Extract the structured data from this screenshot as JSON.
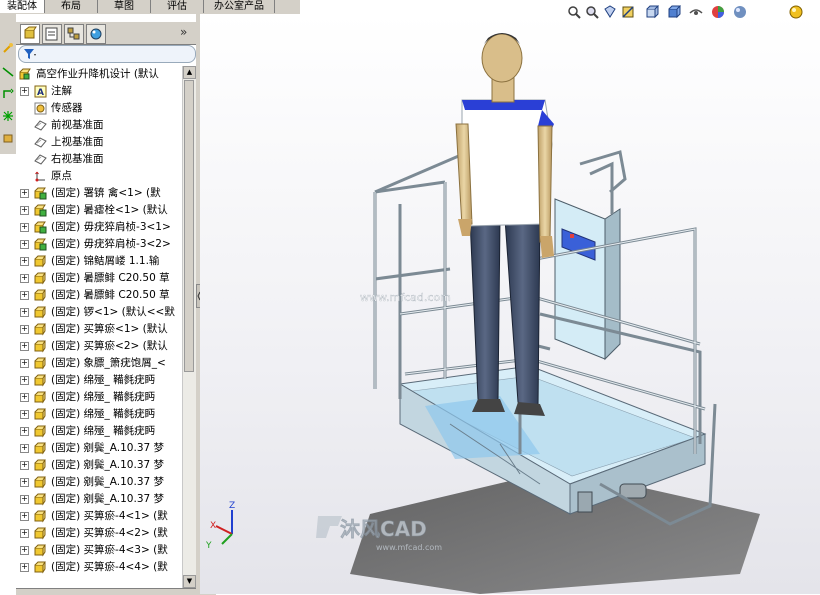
{
  "command_tabs": [
    {
      "label": "装配体",
      "active": true
    },
    {
      "label": "布局",
      "active": false
    },
    {
      "label": "草图",
      "active": false
    },
    {
      "label": "评估",
      "active": false
    },
    {
      "label": "办公室产品",
      "active": false
    }
  ],
  "tree": {
    "root": "高空作业升降机设计  (默认",
    "items": [
      {
        "label": "注解",
        "icon": "annotation-icon",
        "expand": true
      },
      {
        "label": "传感器",
        "icon": "sensor-icon",
        "expand": false
      },
      {
        "label": "前视基准面",
        "icon": "plane-icon",
        "expand": false
      },
      {
        "label": "上视基准面",
        "icon": "plane-icon",
        "expand": false
      },
      {
        "label": "右视基准面",
        "icon": "plane-icon",
        "expand": false
      },
      {
        "label": "原点",
        "icon": "origin-icon",
        "expand": false
      },
      {
        "label": "(固定) 署锛  禽<1> (默",
        "icon": "subassembly-icon",
        "expand": true
      },
      {
        "label": "(固定) 暑瘧栓<1> (默认",
        "icon": "subassembly-icon",
        "expand": true
      },
      {
        "label": "(固定) 毋疣猝肩桢-3<1>",
        "icon": "subassembly-icon",
        "expand": true
      },
      {
        "label": "(固定) 毋疣猝肩桢-3<2>",
        "icon": "subassembly-icon",
        "expand": true
      },
      {
        "label": "(固定) 锦鲒屑嵝 1.1.输",
        "icon": "part-icon",
        "expand": true
      },
      {
        "label": "(固定) 暑膘鲱 C20.50 草",
        "icon": "part-icon",
        "expand": true
      },
      {
        "label": "(固定) 暑膘鲱 C20.50 草",
        "icon": "part-icon",
        "expand": true
      },
      {
        "label": "(固定) 锣<1> (默认<<默",
        "icon": "part-icon",
        "expand": true
      },
      {
        "label": "(固定) 买箅瘀<1> (默认",
        "icon": "part-icon",
        "expand": true
      },
      {
        "label": "(固定) 买箅瘀<2> (默认",
        "icon": "part-icon",
        "expand": true
      },
      {
        "label": "(固定) 象膘_箫疣饱屑_<",
        "icon": "part-icon",
        "expand": true
      },
      {
        "label": "(固定) 绵殛_  鞴毵疣眄",
        "icon": "part-icon",
        "expand": true
      },
      {
        "label": "(固定) 绵殛_  鞴毵疣眄",
        "icon": "part-icon",
        "expand": true
      },
      {
        "label": "(固定) 绵殛_  鞴毵疣眄",
        "icon": "part-icon",
        "expand": true
      },
      {
        "label": "(固定) 绵殛_  鞴毵疣眄",
        "icon": "part-icon",
        "expand": true
      },
      {
        "label": "(固定) 剜鬓_A.10.37 梦",
        "icon": "part-icon",
        "expand": true
      },
      {
        "label": "(固定) 剜鬓_A.10.37 梦",
        "icon": "part-icon",
        "expand": true
      },
      {
        "label": "(固定) 剜鬓_A.10.37 梦",
        "icon": "part-icon",
        "expand": true
      },
      {
        "label": "(固定) 剜鬓_A.10.37 梦",
        "icon": "part-icon",
        "expand": true
      },
      {
        "label": "(固定) 买箅瘀-4<1> (默",
        "icon": "part-icon",
        "expand": true
      },
      {
        "label": "(固定) 买箅瘀-4<2> (默",
        "icon": "part-icon",
        "expand": true
      },
      {
        "label": "(固定) 买箅瘀-4<3> (默",
        "icon": "part-icon",
        "expand": true
      },
      {
        "label": "(固定) 买箅瘀-4<4> (默",
        "icon": "part-icon",
        "expand": true
      }
    ]
  },
  "viewport": {
    "watermark_url": "www.mfcad.com",
    "logo_text": "沐风CAD",
    "logo_sub": "www.mfcad.com",
    "triad": {
      "x": "X",
      "y": "Y",
      "z": "Z"
    }
  },
  "colors": {
    "shirt": "#ffffff",
    "shirt_accent": "#2a3fd6",
    "pants": "#3a4760",
    "skin": "#d9be8a",
    "frame": "#b8c4cc",
    "panel": "#cce8f4",
    "shadow": "#5c5c5c"
  }
}
